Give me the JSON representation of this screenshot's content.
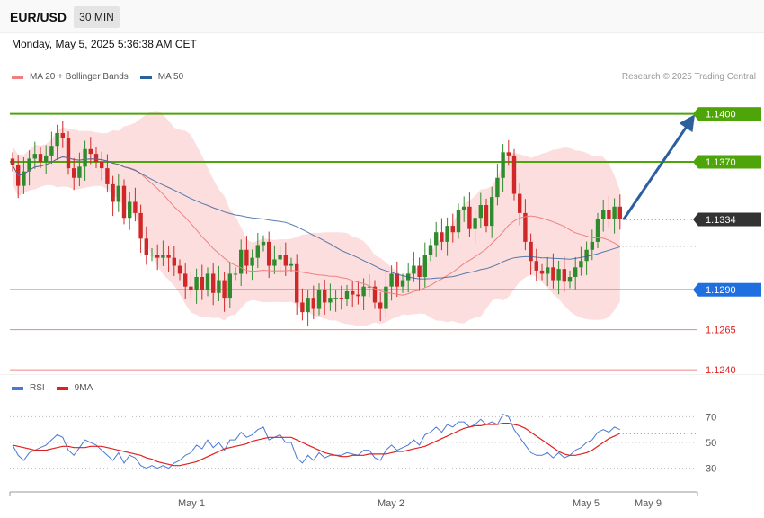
{
  "header": {
    "symbol": "EUR/USD",
    "timeframe": "30 MIN"
  },
  "datetime": "Monday, May 5, 2025 5:36:38 AM CET",
  "legend": {
    "ma20": "MA 20 + Bollinger Bands",
    "ma50": "MA 50",
    "ma20_color": "#f08080",
    "ma50_color": "#2c5f9e"
  },
  "credit": "Research © 2025 Trading Central",
  "rsi_legend": {
    "rsi": "RSI",
    "ma9": "9MA",
    "rsi_color": "#4a78d4",
    "ma9_color": "#e02020"
  },
  "chart_data": [
    {
      "type": "candlestick",
      "title": "",
      "y_range": [
        1.1235,
        1.1415
      ],
      "levels": [
        {
          "value": 1.14,
          "label": "1.1400",
          "kind": "resistance",
          "color": "#4ea50a"
        },
        {
          "value": 1.137,
          "label": "1.1370",
          "kind": "resistance",
          "color": "#4ea50a"
        },
        {
          "value": 1.1334,
          "label": "1.1334",
          "kind": "last-price",
          "color": "#333333"
        },
        {
          "value": 1.129,
          "label": "1.1290",
          "kind": "pivot",
          "color": "#1f6fe0"
        },
        {
          "value": 1.1265,
          "label": "1.1265",
          "kind": "support",
          "color": "#e02020"
        },
        {
          "value": 1.124,
          "label": "1.1240",
          "kind": "support",
          "color": "#e02020"
        }
      ],
      "x_labels": [
        "May 1",
        "May 2",
        "May 5",
        "May 9"
      ],
      "projection": {
        "from": 1.1334,
        "to": 1.14,
        "direction": "up"
      },
      "bollinger_color": "#fbd8d8",
      "up_color": "#2e8b2e",
      "down_color": "#d02828",
      "closes": [
        1.1368,
        1.1355,
        1.1364,
        1.1372,
        1.1375,
        1.137,
        1.1374,
        1.138,
        1.1388,
        1.1385,
        1.1366,
        1.136,
        1.1367,
        1.1378,
        1.1375,
        1.137,
        1.1366,
        1.1356,
        1.1345,
        1.1355,
        1.1335,
        1.1345,
        1.1338,
        1.1322,
        1.1312,
        1.1312,
        1.131,
        1.1312,
        1.131,
        1.1305,
        1.13,
        1.1292,
        1.129,
        1.1298,
        1.129,
        1.13,
        1.1288,
        1.1296,
        1.1285,
        1.13,
        1.13,
        1.1315,
        1.1305,
        1.131,
        1.1318,
        1.132,
        1.1305,
        1.1309,
        1.1312,
        1.1305,
        1.1306,
        1.1282,
        1.1276,
        1.1285,
        1.1278,
        1.129,
        1.1282,
        1.1285,
        1.1285,
        1.1284,
        1.1289,
        1.1287,
        1.1286,
        1.1292,
        1.1292,
        1.1282,
        1.1278,
        1.1292,
        1.13,
        1.1292,
        1.1296,
        1.13,
        1.1305,
        1.1298,
        1.1312,
        1.1318,
        1.1326,
        1.132,
        1.133,
        1.1326,
        1.134,
        1.1342,
        1.1328,
        1.1335,
        1.1343,
        1.133,
        1.1348,
        1.136,
        1.1376,
        1.1374,
        1.135,
        1.1338,
        1.132,
        1.1308,
        1.1302,
        1.13,
        1.1304,
        1.1296,
        1.1303,
        1.1295,
        1.1298,
        1.1304,
        1.1308,
        1.1315,
        1.132,
        1.1334,
        1.134,
        1.1334,
        1.1342,
        1.1334
      ]
    },
    {
      "type": "line",
      "title": "",
      "y_ticks": [
        30,
        50,
        70
      ],
      "y_range": [
        15,
        85
      ],
      "series": [
        {
          "name": "RSI",
          "values": [
            48,
            40,
            36,
            42,
            44,
            46,
            48,
            52,
            56,
            54,
            44,
            40,
            46,
            52,
            50,
            48,
            44,
            40,
            36,
            42,
            34,
            40,
            38,
            32,
            30,
            32,
            30,
            32,
            30,
            34,
            36,
            40,
            42,
            48,
            45,
            52,
            46,
            50,
            44,
            52,
            52,
            58,
            54,
            56,
            60,
            62,
            52,
            54,
            56,
            50,
            50,
            38,
            34,
            40,
            36,
            42,
            38,
            40,
            40,
            40,
            42,
            41,
            40,
            44,
            44,
            38,
            36,
            44,
            48,
            44,
            46,
            48,
            52,
            48,
            56,
            58,
            62,
            58,
            64,
            62,
            66,
            66,
            62,
            64,
            68,
            64,
            66,
            64,
            72,
            70,
            60,
            54,
            48,
            42,
            40,
            40,
            42,
            38,
            42,
            38,
            40,
            44,
            46,
            50,
            52,
            58,
            60,
            58,
            62,
            60
          ]
        },
        {
          "name": "9MA",
          "values": [
            48,
            47,
            46,
            45,
            44,
            44,
            44,
            45,
            46,
            47,
            47,
            46,
            46,
            46,
            47,
            47,
            47,
            46,
            45,
            44,
            43,
            42,
            41,
            40,
            38,
            37,
            35,
            34,
            33,
            32,
            32,
            33,
            34,
            35,
            37,
            39,
            41,
            43,
            45,
            46,
            47,
            48,
            49,
            51,
            52,
            53,
            54,
            54,
            54,
            54,
            54,
            52,
            50,
            48,
            46,
            44,
            42,
            41,
            40,
            39,
            39,
            40,
            40,
            40,
            41,
            41,
            41,
            41,
            42,
            43,
            43,
            44,
            45,
            46,
            47,
            49,
            51,
            53,
            55,
            57,
            59,
            61,
            62,
            63,
            63,
            64,
            64,
            64,
            65,
            65,
            64,
            63,
            61,
            58,
            55,
            52,
            49,
            46,
            43,
            41,
            40,
            40,
            41,
            42,
            44,
            47,
            50,
            53,
            55,
            57
          ]
        }
      ],
      "guide_value": 57
    }
  ]
}
